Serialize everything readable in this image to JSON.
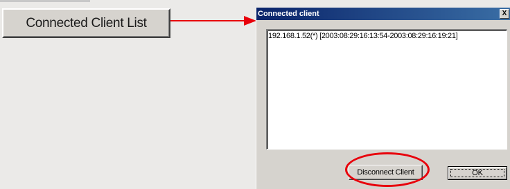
{
  "main_button": {
    "label": "Connected Client List"
  },
  "dialog": {
    "title": "Connected client",
    "close_glyph": "X",
    "list_items": [
      "192.168.1.52(*) [2003:08:29:16:13:54-2003:08:29:16:19:21]"
    ],
    "disconnect_label": "Disconnect Client",
    "ok_label": "OK"
  },
  "annotation": {
    "color": "#e8000b"
  },
  "icons": {
    "arrow": "arrow-right-icon"
  }
}
